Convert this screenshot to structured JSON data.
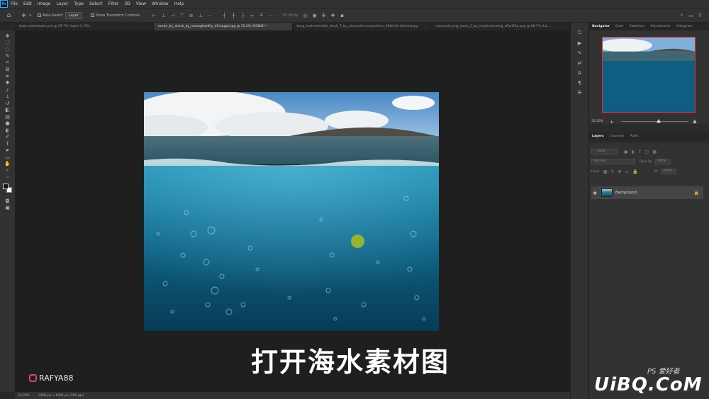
{
  "app": {
    "logo": "Ps"
  },
  "menu": [
    "File",
    "Edit",
    "Image",
    "Layer",
    "Type",
    "Select",
    "Filter",
    "3D",
    "View",
    "Window",
    "Help"
  ],
  "options": {
    "auto_select_label": "Auto-Select",
    "auto_select_value": "Layer",
    "transform_controls_label": "Show Transform Controls",
    "mode_3d_label": "3D Mode:"
  },
  "tabs": [
    {
      "label": "book underwater.psd @ 29.7% (Layer 0, RG...",
      "active": false
    },
    {
      "label": "ocean_by_shock_by_moonglowlilly_d5mpppo.jpg @ 33.3% (RGB/8) *",
      "active": true
    },
    {
      "label": "burg_hochosterwitz_stock_7_by_alexandervonbueltner_d5blh4h-fullview.jpg",
      "active": false
    },
    {
      "label": "mountain_png_stock_2_by_mysticmorning_d5w3f2q.png @ 66.7% (La...",
      "active": false
    }
  ],
  "caption": "打开海水素材图",
  "watermark_left": "RAFYA88",
  "status": {
    "zoom": "33.28%",
    "dims": "2400 px x 1904 px (300 ppi)"
  },
  "navigator": {
    "tabs": [
      "Navigator",
      "Color",
      "Swatches",
      "Adjustments",
      "Histogram"
    ],
    "zoom": "33.28%"
  },
  "layers": {
    "tabs": [
      "Layers",
      "Channels",
      "Paths"
    ],
    "kind_placeholder": "Kind",
    "blend_mode": "Normal",
    "opacity_label": "Opacity:",
    "opacity_value": "100%",
    "lock_label": "Lock:",
    "fill_label": "Fill:",
    "fill_value": "100%",
    "items": [
      {
        "name": "Background",
        "visible": true,
        "locked": true
      }
    ]
  },
  "watermark_right": "UiBQ.CoM",
  "watermark_ps": "PS 爱好者"
}
